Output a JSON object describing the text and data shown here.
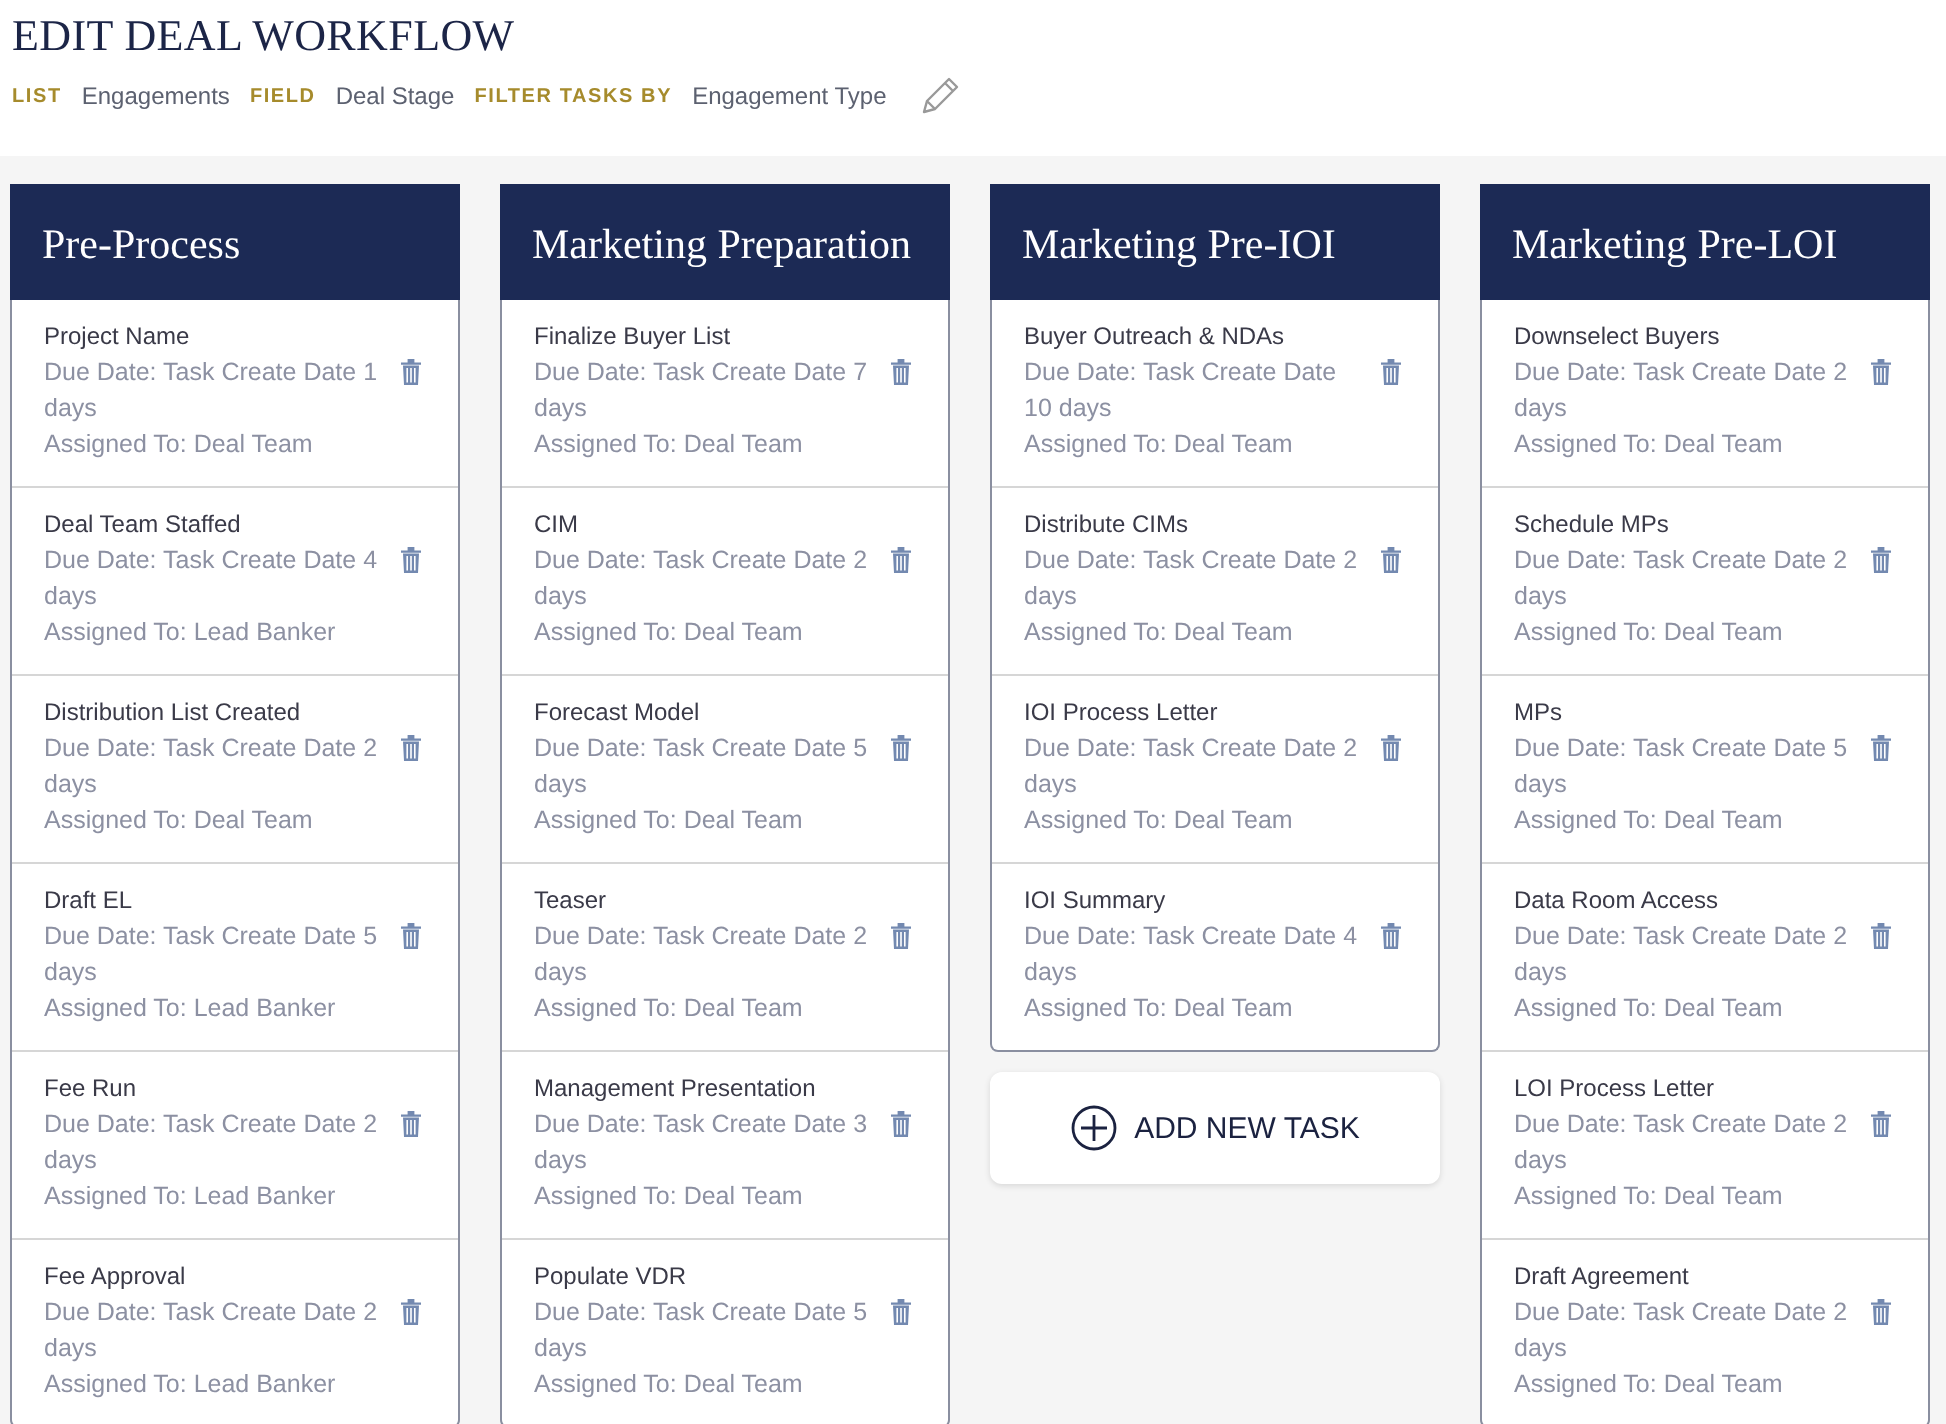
{
  "page": {
    "title": "EDIT DEAL WORKFLOW"
  },
  "meta": [
    {
      "label": "LIST",
      "value": "Engagements"
    },
    {
      "label": "FIELD",
      "value": "Deal Stage"
    },
    {
      "label": "FILTER TASKS BY",
      "value": "Engagement Type"
    }
  ],
  "columns": [
    {
      "title": "Pre-Process",
      "tasks": [
        {
          "name": "Project Name",
          "due": "Due Date: Task Create Date 1 days",
          "assigned": "Assigned To: Deal Team"
        },
        {
          "name": "Deal Team Staffed",
          "due": "Due Date: Task Create Date 4 days",
          "assigned": "Assigned To: Lead Banker"
        },
        {
          "name": "Distribution List Created",
          "due": "Due Date: Task Create Date 2 days",
          "assigned": "Assigned To: Deal Team"
        },
        {
          "name": "Draft EL",
          "due": "Due Date: Task Create Date 5 days",
          "assigned": "Assigned To: Lead Banker"
        },
        {
          "name": "Fee Run",
          "due": "Due Date: Task Create Date 2 days",
          "assigned": "Assigned To: Lead Banker"
        },
        {
          "name": "Fee Approval",
          "due": "Due Date: Task Create Date 2 days",
          "assigned": "Assigned To: Lead Banker"
        }
      ]
    },
    {
      "title": "Marketing Preparation",
      "tasks": [
        {
          "name": "Finalize Buyer List",
          "due": "Due Date: Task Create Date 7 days",
          "assigned": "Assigned To: Deal Team"
        },
        {
          "name": "CIM",
          "due": "Due Date: Task Create Date 2 days",
          "assigned": "Assigned To: Deal Team"
        },
        {
          "name": "Forecast Model",
          "due": "Due Date: Task Create Date 5 days",
          "assigned": "Assigned To: Deal Team"
        },
        {
          "name": "Teaser",
          "due": "Due Date: Task Create Date 2 days",
          "assigned": "Assigned To: Deal Team"
        },
        {
          "name": "Management Presentation",
          "due": "Due Date: Task Create Date 3 days",
          "assigned": "Assigned To: Deal Team"
        },
        {
          "name": "Populate VDR",
          "due": "Due Date: Task Create Date 5 days",
          "assigned": "Assigned To: Deal Team"
        }
      ]
    },
    {
      "title": "Marketing Pre-IOI",
      "tasks": [
        {
          "name": "Buyer Outreach & NDAs",
          "due": "Due Date: Task Create Date 10 days",
          "assigned": "Assigned To: Deal Team"
        },
        {
          "name": "Distribute CIMs",
          "due": "Due Date: Task Create Date 2 days",
          "assigned": "Assigned To: Deal Team"
        },
        {
          "name": "IOI Process Letter",
          "due": "Due Date: Task Create Date 2 days",
          "assigned": "Assigned To: Deal Team"
        },
        {
          "name": "IOI Summary",
          "due": "Due Date: Task Create Date 4 days",
          "assigned": "Assigned To: Deal Team"
        }
      ],
      "add_button": {
        "label": "ADD NEW TASK"
      }
    },
    {
      "title": "Marketing Pre-LOI",
      "tasks": [
        {
          "name": "Downselect Buyers",
          "due": "Due Date: Task Create Date 2 days",
          "assigned": "Assigned To: Deal Team"
        },
        {
          "name": "Schedule MPs",
          "due": "Due Date: Task Create Date 2 days",
          "assigned": "Assigned To: Deal Team"
        },
        {
          "name": "MPs",
          "due": "Due Date: Task Create Date 5 days",
          "assigned": "Assigned To: Deal Team"
        },
        {
          "name": "Data Room Access",
          "due": "Due Date: Task Create Date 2 days",
          "assigned": "Assigned To: Deal Team"
        },
        {
          "name": "LOI Process Letter",
          "due": "Due Date: Task Create Date 2 days",
          "assigned": "Assigned To: Deal Team"
        },
        {
          "name": "Draft Agreement",
          "due": "Due Date: Task Create Date 2 days",
          "assigned": "Assigned To: Deal Team"
        }
      ]
    }
  ]
}
